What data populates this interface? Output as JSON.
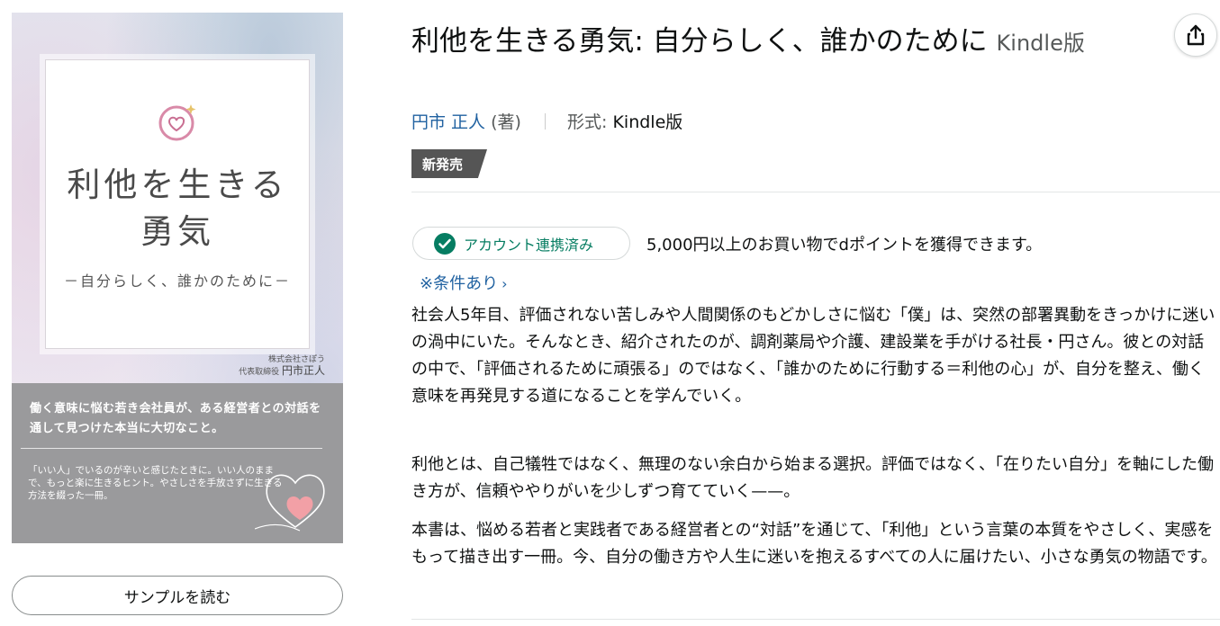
{
  "cover": {
    "title_line1": "利他を生きる",
    "title_line2": "勇気",
    "subtitle": "－自分らしく、誰かのために－",
    "company": "株式会社さぽう",
    "author_role": "代表取締役",
    "author": "円市正人",
    "band_lead": "働く意味に悩む若き会社員が、ある経営者との対話を通して見つけた本当に大切なこと。",
    "band_body": "「いい人」でいるのが辛いと感じたときに。いい人のままで、もっと楽に生きるヒント。やさしさを手放さずに生きる方法を綴った一冊。"
  },
  "sample_button": "サンプルを読む",
  "product": {
    "title": "利他を生きる勇気: 自分らしく、誰かのために",
    "format_suffix": "Kindle版",
    "author_name": "円市 正人",
    "author_role": "(著)",
    "format_label": "形式:",
    "format_value": "Kindle版",
    "badge": "新発売"
  },
  "dpoint": {
    "account_status": "アカウント連携済み",
    "offer": "5,000円以上のお買い物でdポイントを獲得できます。",
    "conditions": "※条件あり"
  },
  "description": [
    "社会人5年目、評価されない苦しみや人間関係のもどかしさに悩む「僕」は、突然の部署異動をきっかけに迷いの渦中にいた。そんなとき、紹介されたのが、調剤薬局や介護、建設業を手がける社長・円さん。彼との対話の中で、「評価されるために頑張る」のではなく、「誰かのために行動する＝利他の心」が、自分を整え、働く意味を再発見する道になることを学んでいく。",
    "利他とは、自己犠牲ではなく、無理のない余白から始まる選択。評価ではなく、「在りたい自分」を軸にした働き方が、信頼ややりがいを少しずつ育てていく——。",
    "本書は、悩める若者と実践者である経営者との“対話”を通じて、「利他」という言葉の本質をやさしく、実感をもって描き出す一冊。今、自分の働き方や人生に迷いを抱えるすべての人に届けたい、小さな勇気の物語です。"
  ],
  "icons": {
    "share": "share-icon",
    "check": "check-circle-icon",
    "logo": "heart-logo-icon",
    "heart": "heart-illustration"
  },
  "colors": {
    "link": "#2162a1",
    "success": "#067d62",
    "badge_bg": "#555555",
    "cover_band": "#9a9a9c"
  }
}
